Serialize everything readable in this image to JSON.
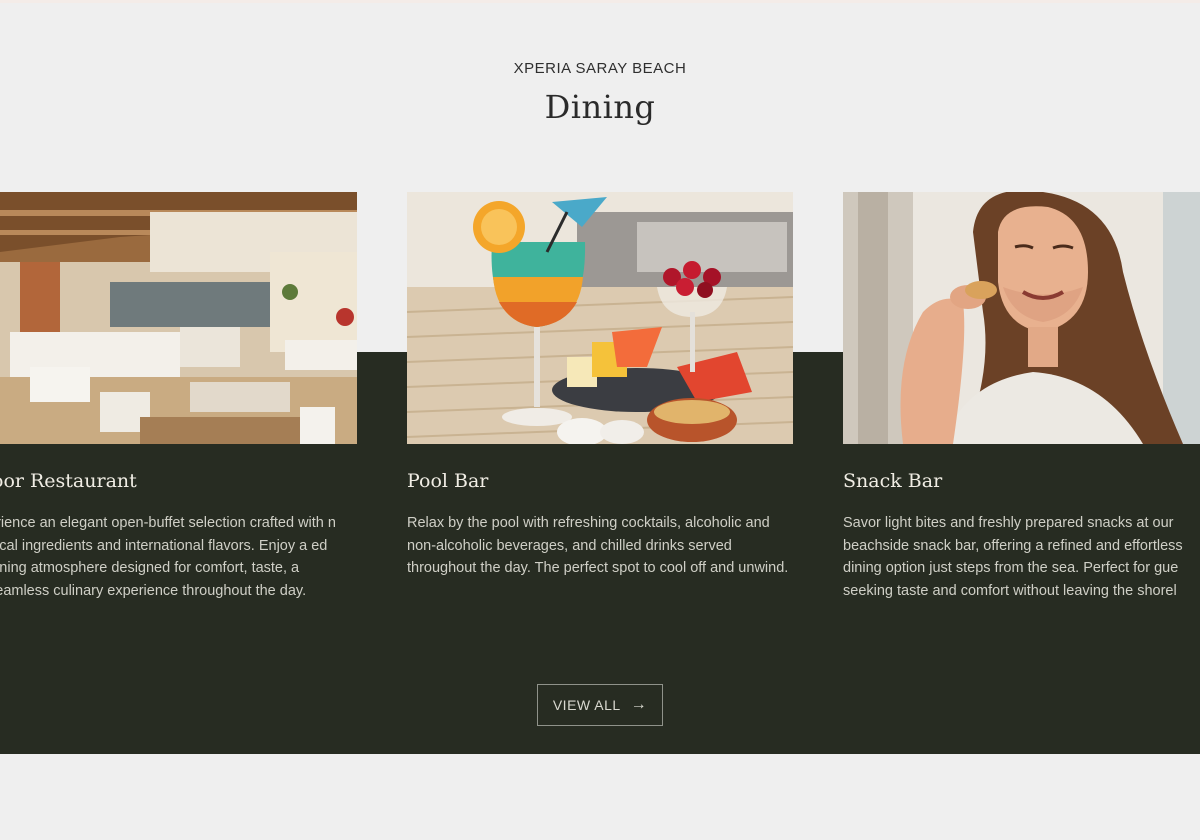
{
  "header": {
    "eyebrow": "XPERIA SARAY BEACH",
    "title": "Dining"
  },
  "cards": [
    {
      "title": "oor Restaurant",
      "description": "erience an elegant open-buffet selection crafted with n local ingredients and international flavors. Enjoy a ed dining atmosphere designed for comfort, taste, a seamless culinary experience throughout the day.",
      "image": "restaurant-interior"
    },
    {
      "title": "Pool Bar",
      "description": "Relax by the pool with refreshing cocktails, alcoholic and non-alcoholic beverages, and chilled drinks served throughout the day. The perfect spot to cool off and unwind.",
      "image": "cocktail-and-fruit"
    },
    {
      "title": "Snack Bar",
      "description": "Savor light bites and freshly prepared snacks at our beachside snack bar, offering a refined and effortless dining option just steps from the sea. Perfect for gue seeking taste and comfort without leaving the shorel",
      "image": "woman-eating-snack"
    }
  ],
  "cta": {
    "label": "VIEW ALL",
    "icon": "arrow-right-icon"
  },
  "colors": {
    "page_bg": "#efefef",
    "dark_band": "#272c22",
    "card_title": "#f0ede4",
    "card_text": "#cfcfc6"
  }
}
